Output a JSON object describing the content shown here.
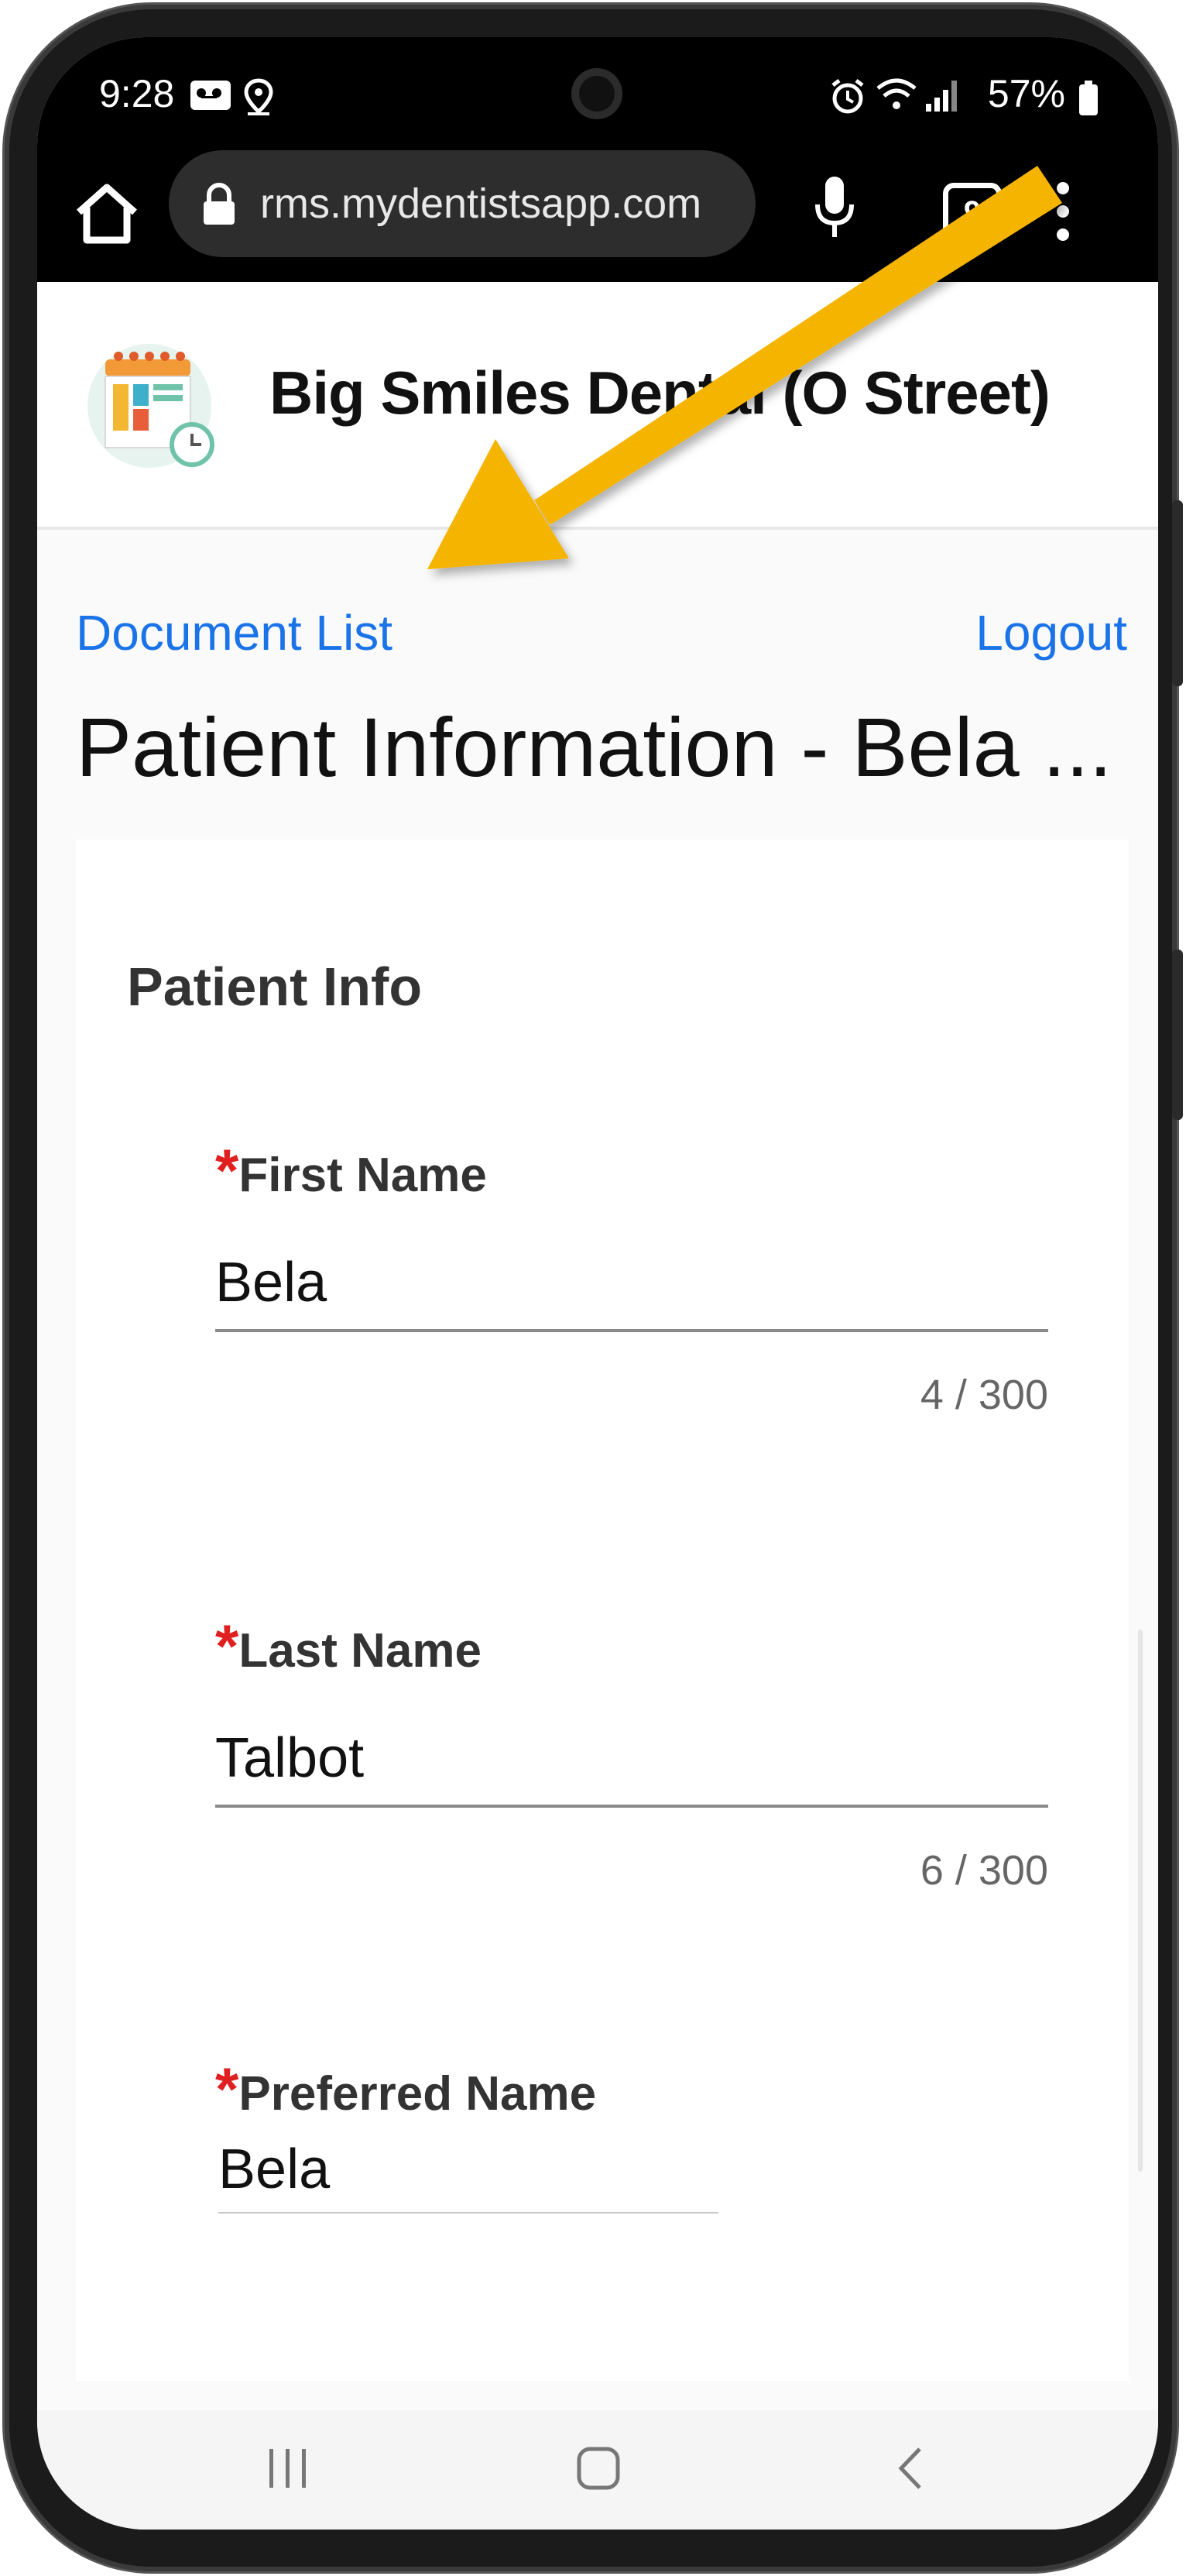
{
  "status_bar": {
    "time": "9:28",
    "battery": "57%"
  },
  "browser": {
    "url": "rms.mydentistsapp.com",
    "tab_count": "9"
  },
  "site": {
    "title": "Big Smiles Dental (O Street)"
  },
  "nav": {
    "document_list": "Document List",
    "logout": "Logout"
  },
  "page": {
    "title": "Patient Information - Bela ..."
  },
  "form": {
    "section_title": "Patient Info",
    "required_mark": "*",
    "fields": [
      {
        "label": "First Name",
        "value": "Bela",
        "counter": "4 / 300"
      },
      {
        "label": "Last Name",
        "value": "Talbot",
        "counter": "6 / 300"
      },
      {
        "label": "Preferred Name",
        "value": "Bela"
      }
    ]
  },
  "colors": {
    "link": "#1a73e8",
    "required": "#e02020",
    "arrow": "#f5b400"
  },
  "icons": [
    "home-icon",
    "lock-icon",
    "mic-icon",
    "tabs-icon",
    "more-vert-icon",
    "recent-apps-icon",
    "home-nav-icon",
    "back-icon"
  ]
}
